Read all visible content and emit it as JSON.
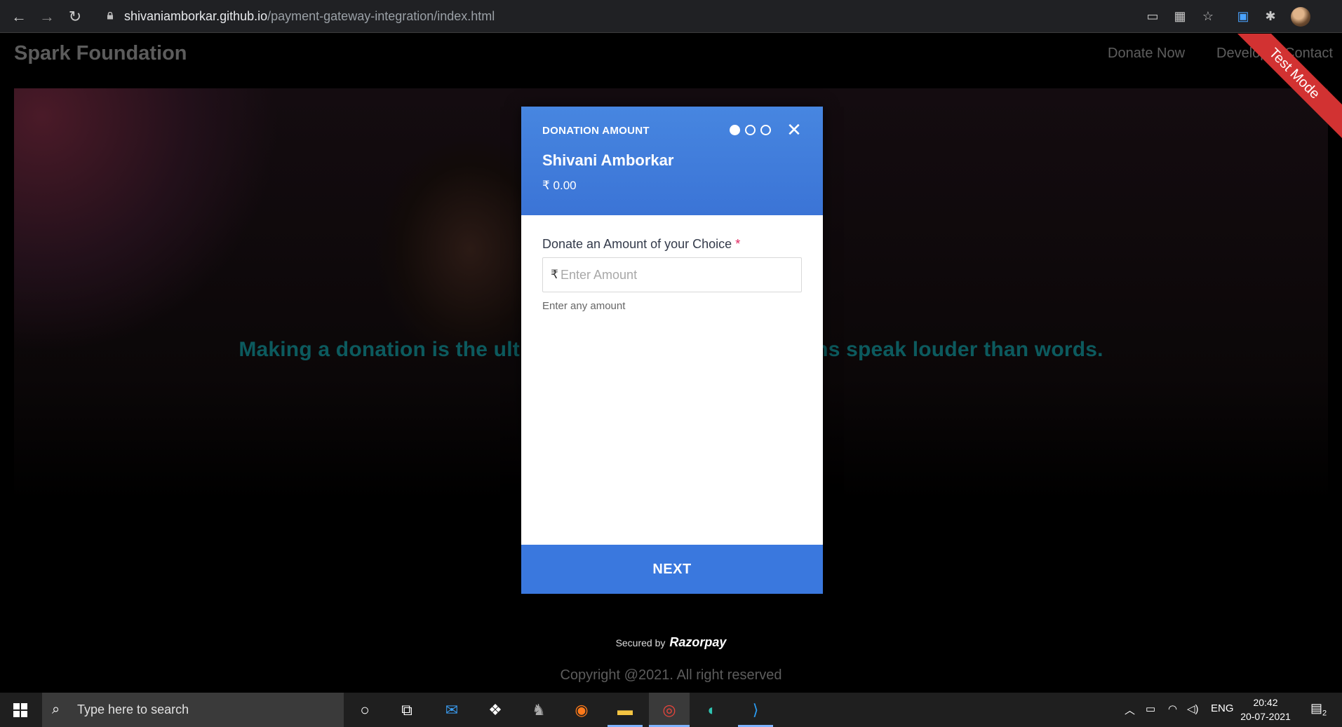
{
  "browser": {
    "url_host": "shivaniamborkar.github.io",
    "url_path": "/payment-gateway-integration/index.html"
  },
  "site": {
    "brand": "Spark Foundation",
    "nav": [
      "Donate Now",
      "Developer",
      "Contact"
    ],
    "ribbon": "Test Mode",
    "hero_text": "Making a donation is the ultimate sign of solidarity. Actions speak louder than words.",
    "secured_by": "Secured by",
    "razorpay": "Razorpay",
    "copyright": "Copyright @2021. All right reserved"
  },
  "modal": {
    "step_title": "DONATION AMOUNT",
    "steps_total": 3,
    "steps_current": 1,
    "close_glyph": "✕",
    "payee_name": "Shivani Amborkar",
    "amount": "₹ 0.00",
    "field_label": "Donate an Amount of your Choice",
    "required_mark": "*",
    "currency_symbol": "₹",
    "input_placeholder": "Enter Amount",
    "hint": "Enter any amount",
    "next_label": "NEXT"
  },
  "taskbar": {
    "search_placeholder": "Type here to search",
    "language": "ENG",
    "time": "20:42",
    "date": "20-07-2021",
    "notification_count": "2"
  },
  "colors": {
    "modal_header": "#3b74d6",
    "next_button": "#3a78de",
    "hero_text": "#0c5a5e",
    "ribbon": "#d23232"
  }
}
